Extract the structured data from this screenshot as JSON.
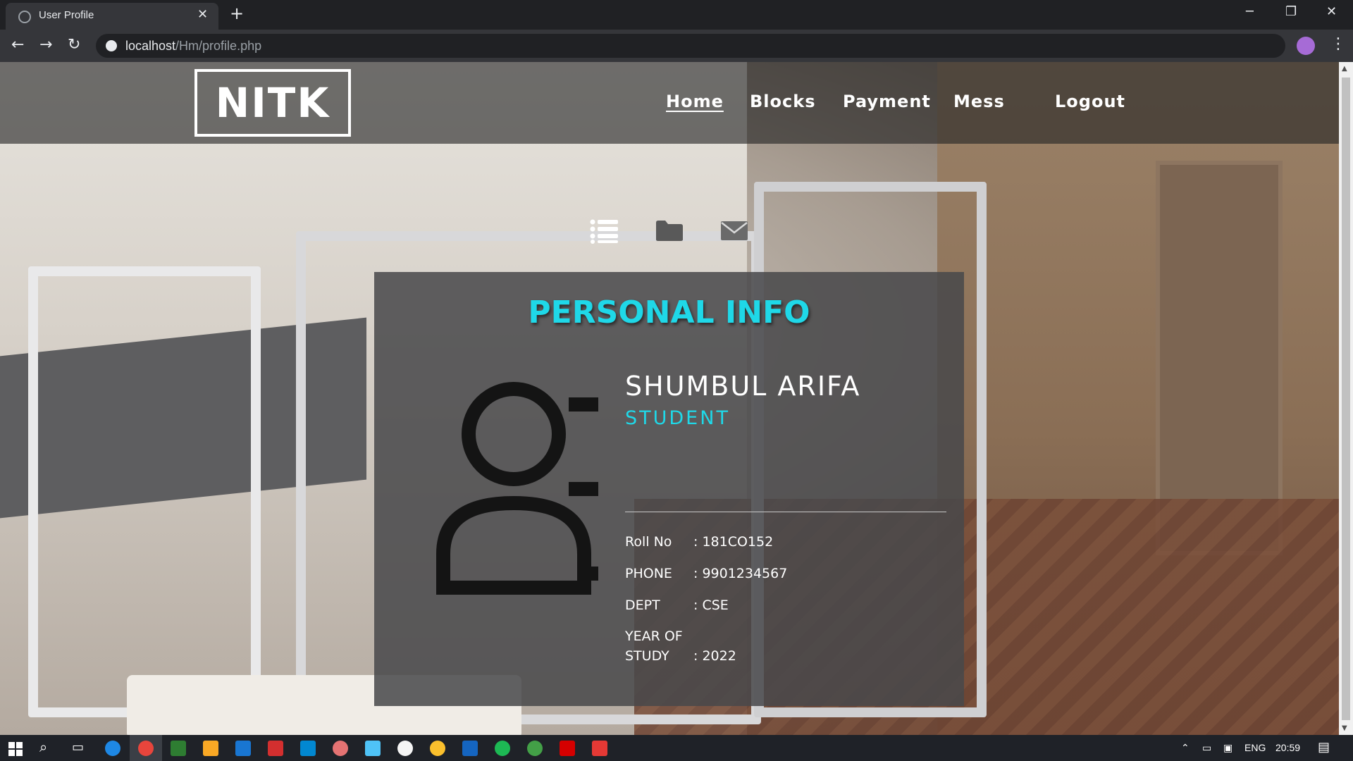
{
  "browser": {
    "tab_title": "User Profile",
    "tab_close": "✕",
    "new_tab": "+",
    "url_host": "localhost",
    "url_path": "/Hm/profile.php",
    "window_controls": {
      "minimize": "─",
      "restore": "❐",
      "close": "✕"
    }
  },
  "site": {
    "logo": "NITK",
    "nav": [
      {
        "label": "Home",
        "active": true
      },
      {
        "label": "Blocks",
        "active": false
      },
      {
        "label": "Payment",
        "active": false
      },
      {
        "label": "Mess",
        "active": false
      },
      {
        "label": "Logout",
        "active": false
      }
    ],
    "tab_icons": [
      "list-icon",
      "folder-icon",
      "envelope-icon"
    ]
  },
  "profile": {
    "title": "PERSONAL INFO",
    "name": "SHUMBUL ARIFA",
    "role": "STUDENT",
    "fields": [
      {
        "label": "Roll No",
        "value": ": 181CO152"
      },
      {
        "label": "PHONE",
        "value": ": 9901234567"
      },
      {
        "label": "DEPT",
        "value": ": CSE"
      },
      {
        "label": "YEAR OF STUDY",
        "value": ": 2022"
      }
    ]
  },
  "taskbar": {
    "language": "ENG",
    "time": "20:59"
  },
  "colors": {
    "accent_cyan": "#1fd8e8",
    "header_bg": "#232323",
    "card_bg": "#48484a"
  }
}
